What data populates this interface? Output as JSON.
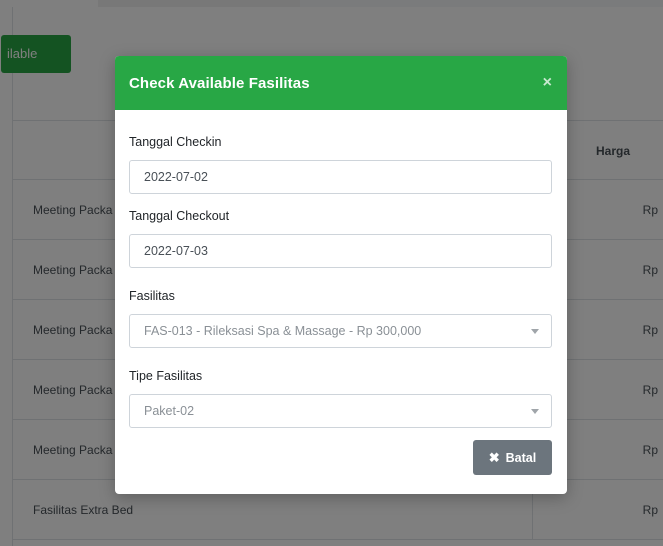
{
  "background": {
    "available_button_label": "ilable",
    "table": {
      "header": {
        "col_a": "",
        "col_b": "Harga"
      },
      "rows": [
        {
          "name": "Meeting Packa",
          "price": "Rp"
        },
        {
          "name": "Meeting Packa",
          "price": "Rp"
        },
        {
          "name": "Meeting Packa",
          "price": "Rp"
        },
        {
          "name": "Meeting Packa",
          "price": "Rp"
        },
        {
          "name": "Meeting Packa",
          "price": "Rp"
        },
        {
          "name": "Fasilitas Extra Bed",
          "price": "Rp"
        }
      ]
    }
  },
  "modal": {
    "title": "Check Available Fasilitas",
    "close_icon": "×",
    "fields": {
      "checkin": {
        "label": "Tanggal Checkin",
        "value": "2022-07-02"
      },
      "checkout": {
        "label": "Tanggal Checkout",
        "value": "2022-07-03"
      },
      "fasilitas": {
        "label": "Fasilitas",
        "value": "FAS-013 - Rileksasi Spa & Massage - Rp 300,000"
      },
      "tipe": {
        "label": "Tipe Fasilitas",
        "value": "Paket-02"
      }
    },
    "cancel_button": {
      "icon": "✖",
      "label": "Batal"
    }
  },
  "colors": {
    "accent_green": "#28a745",
    "secondary_gray": "#6c757d"
  }
}
